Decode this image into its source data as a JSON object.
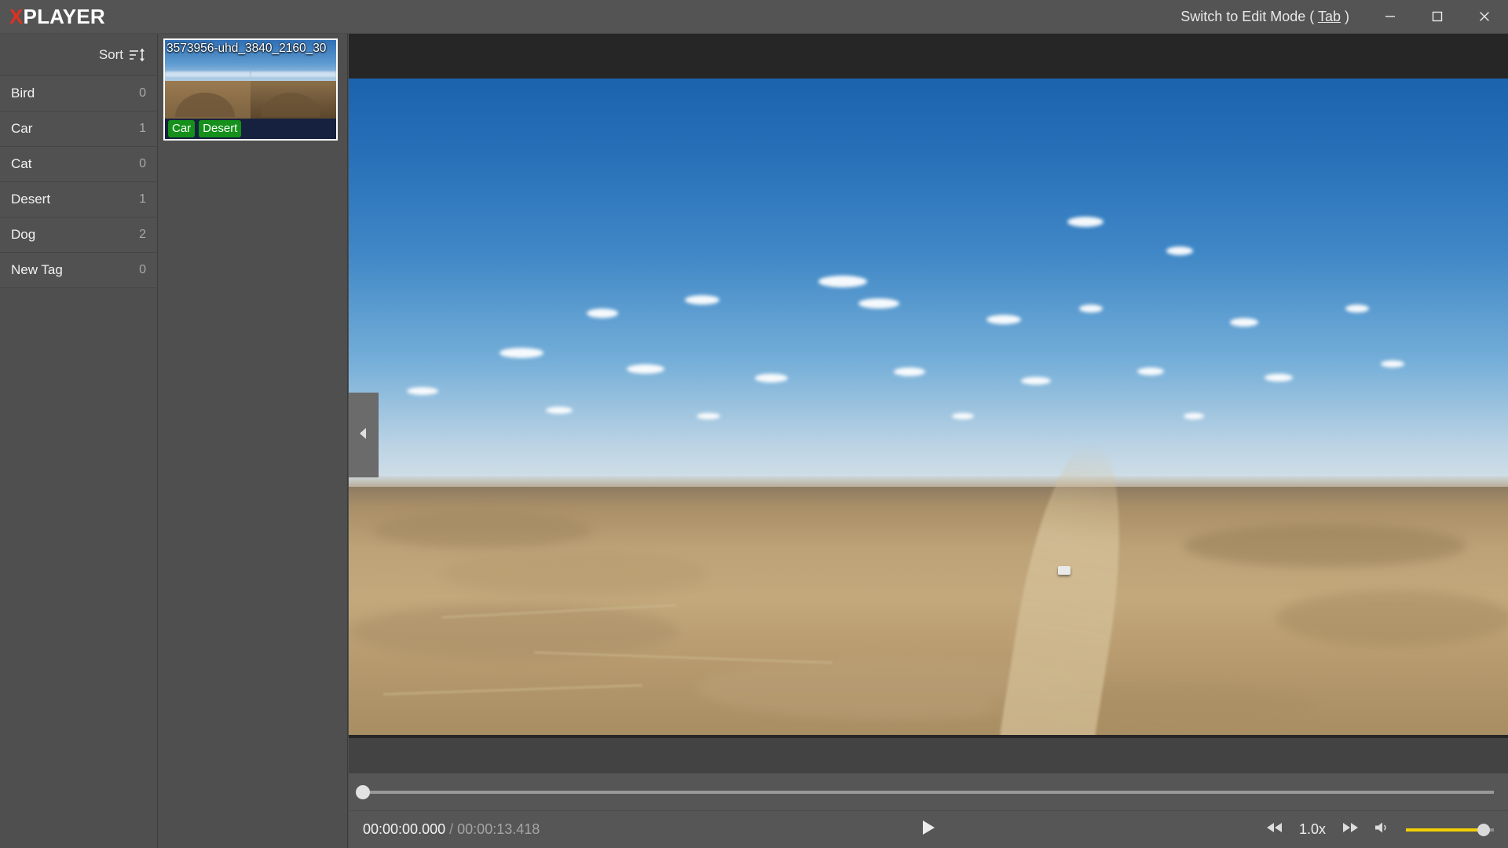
{
  "app": {
    "logo_x": "X",
    "logo_rest": "PLAYER",
    "brand_accent": "#e03020"
  },
  "titlebar": {
    "edit_mode_prefix": "Switch to Edit Mode ( ",
    "edit_mode_key": "Tab",
    "edit_mode_suffix": " )",
    "minimize_icon": "minimize-icon",
    "maximize_icon": "maximize-icon",
    "close_icon": "close-icon"
  },
  "sidebar": {
    "sort_label": "Sort",
    "sort_icon": "sort-icon",
    "tags": [
      {
        "name": "Bird",
        "count": "0"
      },
      {
        "name": "Car",
        "count": "1"
      },
      {
        "name": "Cat",
        "count": "0"
      },
      {
        "name": "Desert",
        "count": "1"
      },
      {
        "name": "Dog",
        "count": "2"
      },
      {
        "name": "New Tag",
        "count": "0"
      }
    ]
  },
  "thumbnails": {
    "items": [
      {
        "filename": "3573956-uhd_3840_2160_30",
        "tags": [
          "Car",
          "Desert"
        ],
        "selected": true,
        "tag_badge_color": "#14901b"
      }
    ]
  },
  "panel_toggle": {
    "icon": "chevron-left-icon"
  },
  "player": {
    "seek_position_percent": 0,
    "time_current": "00:00:00.000",
    "time_separator": "/",
    "time_duration": "00:00:13.418",
    "play_icon": "play-icon",
    "rewind_icon": "rewind-icon",
    "forward_icon": "fast-forward-icon",
    "speed_label": "1.0x",
    "volume_icon": "volume-icon",
    "volume_percent": 88,
    "volume_color": "#f2d002"
  }
}
